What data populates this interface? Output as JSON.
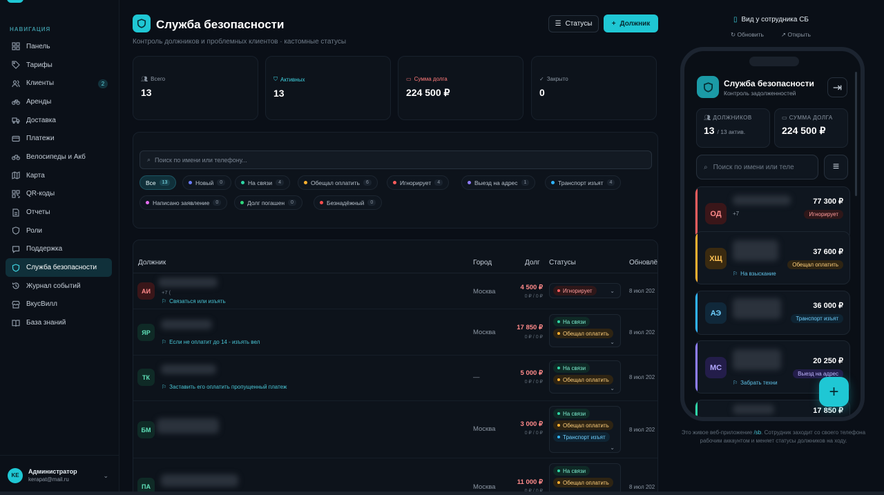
{
  "sidebar": {
    "nav_heading": "НАВИГАЦИЯ",
    "items": [
      {
        "label": "Панель",
        "icon": "dashboard-icon"
      },
      {
        "label": "Тарифы",
        "icon": "tag-icon"
      },
      {
        "label": "Клиенты",
        "icon": "users-icon",
        "badge": "2"
      },
      {
        "label": "Аренды",
        "icon": "bike-icon"
      },
      {
        "label": "Доставка",
        "icon": "truck-icon"
      },
      {
        "label": "Платежи",
        "icon": "card-icon"
      },
      {
        "label": "Велосипеды и Акб",
        "icon": "bike-icon"
      },
      {
        "label": "Карта",
        "icon": "map-icon"
      },
      {
        "label": "QR-коды",
        "icon": "qr-icon"
      },
      {
        "label": "Отчеты",
        "icon": "chart-icon"
      },
      {
        "label": "Роли",
        "icon": "shield-icon"
      },
      {
        "label": "Поддержка",
        "icon": "chat-icon"
      },
      {
        "label": "Служба безопасности",
        "icon": "shield-icon",
        "active": true
      },
      {
        "label": "Журнал событий",
        "icon": "history-icon"
      },
      {
        "label": "ВкусВилл",
        "icon": "store-icon"
      },
      {
        "label": "База знаний",
        "icon": "book-icon"
      }
    ],
    "user": {
      "initials": "KE",
      "name": "Администратор",
      "email": "kerapat@mail.ru"
    }
  },
  "header": {
    "title": "Служба безопасности",
    "subtitle": "Контроль должников и проблемных клиентов · кастомные статусы",
    "statuses_button": "Статусы",
    "add_button": "Должник"
  },
  "stats": [
    {
      "label": "Всего",
      "value": "13",
      "color": "#8b96a3"
    },
    {
      "label": "Активных",
      "value": "13",
      "color": "#3fd2e0"
    },
    {
      "label": "Сумма долга",
      "value": "224 500 ₽",
      "color": "#ff7a7a"
    },
    {
      "label": "Закрыто",
      "value": "0",
      "color": "#8b96a3"
    }
  ],
  "filters": {
    "search_placeholder": "Поиск по имени или телефону...",
    "chips": [
      {
        "label": "Все",
        "count": "13",
        "active": true
      },
      {
        "label": "Новый",
        "count": "0",
        "color": "#6a7cff"
      },
      {
        "label": "На связи",
        "count": "4",
        "color": "#2fd6a6"
      },
      {
        "label": "Обещал оплатить",
        "count": "6",
        "color": "#ffb02e"
      },
      {
        "label": "Игнорирует",
        "count": "4",
        "color": "#ff5c5c"
      },
      {
        "label": "Выезд на адрес",
        "count": "1",
        "color": "#8f7cff"
      },
      {
        "label": "Транспорт изъят",
        "count": "4",
        "color": "#2fb4ff"
      },
      {
        "label": "Написано заявление",
        "count": "0",
        "color": "#e56cf0"
      },
      {
        "label": "Долг погашен",
        "count": "0",
        "color": "#2fd67a"
      },
      {
        "label": "Безнадёжный",
        "count": "0",
        "color": "#ff4d4d"
      }
    ]
  },
  "table": {
    "headers": {
      "debtor": "Должник",
      "city": "Город",
      "debt": "Долг",
      "statuses": "Статусы",
      "updated": "Обновлё"
    },
    "rows": [
      {
        "initials": "АИ",
        "phone": "+7 (",
        "note": "Связаться или изъять",
        "city": "Москва",
        "debt": "4 500 ₽",
        "paid": "0 ₽ / 0 ₽",
        "statuses": [
          "Игнорирует"
        ],
        "date": "8 июл 202"
      },
      {
        "initials": "ЯР",
        "phone": "",
        "note": "Если не оплатит до 14 - изъять вел",
        "city": "Москва",
        "debt": "17 850 ₽",
        "paid": "0 ₽ / 0 ₽",
        "statuses": [
          "На связи",
          "Обещал оплатить"
        ],
        "date": "8 июл 202"
      },
      {
        "initials": "ТК",
        "phone": "",
        "note": "Заставить его оплатить пропущенный платеж",
        "city": "—",
        "debt": "5 000 ₽",
        "paid": "0 ₽ / 0 ₽",
        "statuses": [
          "На связи",
          "Обещал оплатить"
        ],
        "date": "8 июл 202"
      },
      {
        "initials": "БМ",
        "phone": "",
        "note": "",
        "city": "Москва",
        "debt": "3 000 ₽",
        "paid": "0 ₽ / 0 ₽",
        "statuses": [
          "На связи",
          "Обещал оплатить",
          "Транспорт изъят"
        ],
        "date": "8 июл 202"
      },
      {
        "initials": "ПА",
        "phone": "",
        "note": "",
        "city": "Москва",
        "debt": "11 000 ₽",
        "paid": "0 ₽ / 0 ₽",
        "statuses": [
          "На связи",
          "Обещал оплатить"
        ],
        "date": "8 июл 202"
      }
    ]
  },
  "preview": {
    "title": "Вид у сотрудника СБ",
    "refresh": "Обновить",
    "open": "Открыть",
    "app_title": "Служба безопасности",
    "app_subtitle": "Контроль задолженностей",
    "debtors_label": "ДОЛЖНИКОВ",
    "debtors_value": "13",
    "debtors_active": "/ 13 актив.",
    "sum_label": "СУММА ДОЛГА",
    "sum_value": "224 500 ₽",
    "search_placeholder": "Поиск по имени или теле",
    "cards": [
      {
        "initials": "ОД",
        "phone": "+7",
        "amount": "77 300 ₽",
        "status": "Игнорирует",
        "note": ""
      },
      {
        "initials": "ХЩ",
        "phone": "",
        "amount": "37 600 ₽",
        "status": "Обещал оплатить",
        "note": "На взыскание"
      },
      {
        "initials": "АЭ",
        "phone": "",
        "amount": "36 000 ₽",
        "status": "Транспорт изъят",
        "note": ""
      },
      {
        "initials": "МС",
        "phone": "",
        "amount": "20 250 ₽",
        "status": "Выезд на адрес",
        "note": "Забрать техни"
      },
      {
        "initials": "Я",
        "phone": "",
        "amount": "17 850 ₽",
        "status": "",
        "note": ""
      }
    ],
    "note_pre": "Это живое веб-приложение ",
    "note_link": "/sb",
    "note_post": ". Сотрудник заходит со своего телефона рабочим аккаунтом и меняет статусы должников на ходу."
  }
}
